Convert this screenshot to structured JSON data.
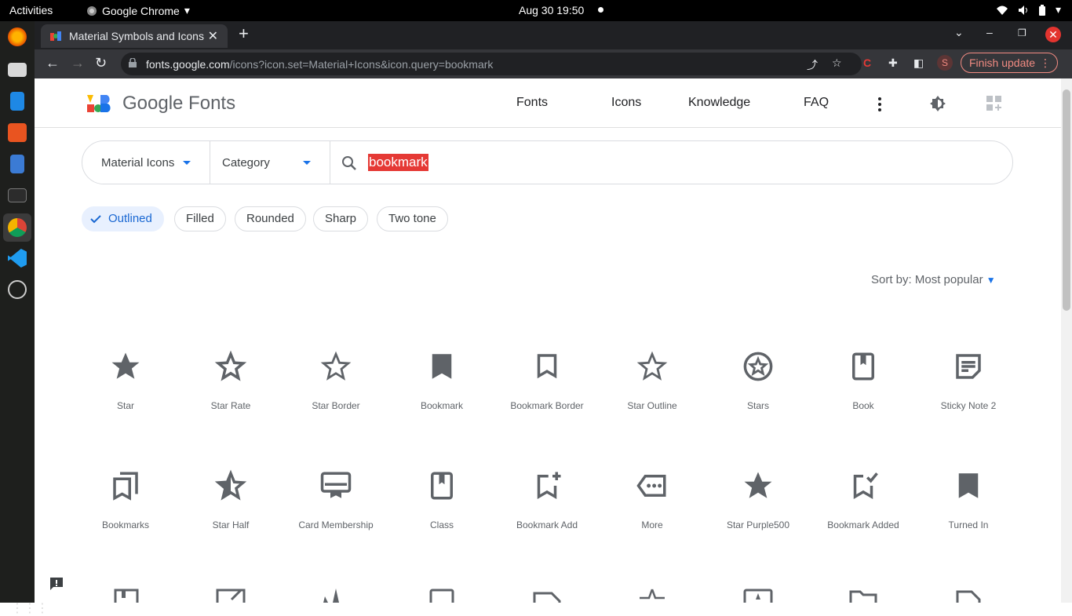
{
  "system": {
    "activities": "Activities",
    "app_name": "Google Chrome",
    "clock": "Aug 30  19:50"
  },
  "browser": {
    "tab_title": "Material Symbols and Icons",
    "url_host": "fonts.google.com",
    "url_path": "/icons?icon.set=Material+Icons&icon.query=bookmark",
    "profile_initial": "S",
    "finish_update": "Finish update"
  },
  "site": {
    "brand": "Google Fonts",
    "nav": [
      "Fonts",
      "Icons",
      "Knowledge",
      "FAQ"
    ]
  },
  "search": {
    "icon_set": "Material Icons",
    "category": "Category",
    "query": "bookmark"
  },
  "styles": [
    "Outlined",
    "Filled",
    "Rounded",
    "Sharp",
    "Two tone"
  ],
  "sort_label": "Sort by: Most popular",
  "icons_row1": [
    "Star",
    "Star Rate",
    "Star Border",
    "Bookmark",
    "Bookmark Border",
    "Star Outline",
    "Stars",
    "Book",
    "Sticky Note 2"
  ],
  "icons_row2": [
    "Bookmarks",
    "Star Half",
    "Card Membership",
    "Class",
    "Bookmark Add",
    "More",
    "Star Purple500",
    "Bookmark Added",
    "Turned In"
  ],
  "colors": {
    "accent": "#1a73e8",
    "icon_gray": "#5f6368",
    "chip_selected": "#e8f0fe",
    "query_highlight": "#e53935"
  }
}
